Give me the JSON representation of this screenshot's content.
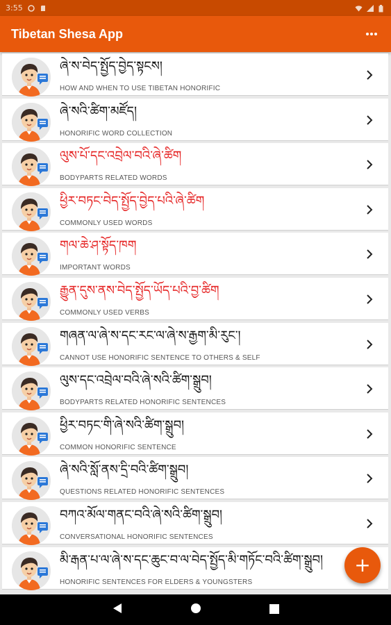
{
  "status_bar": {
    "time": "3:55"
  },
  "app_bar": {
    "title": "Tibetan Shesa App"
  },
  "colors": {
    "accent": "#e8590c",
    "title_black": "#111111",
    "title_red": "#e52222"
  },
  "items": [
    {
      "title": "ཞེ་ས་བེད་སྤྱོད་བྱེད་སྟངས།",
      "subtitle": "HOW AND WHEN TO USE TIBETAN HONORIFIC",
      "color": "black"
    },
    {
      "title": "ཞེ་སའི་ཚིག་མཛོད།",
      "subtitle": "HONORIFIC WORD COLLECTION",
      "color": "black"
    },
    {
      "title": "ལུས་པོ་དང་འབྲེལ་བའི་ཞེ་ཚིག",
      "subtitle": "BODYPARTS RELATED WORDS",
      "color": "red"
    },
    {
      "title": "ཕྱིར་བཏང་བེད་སྤྱོད་བྱེད་པའི་ཞེ་ཚིག",
      "subtitle": "COMMONLY USED WORDS",
      "color": "red"
    },
    {
      "title": "གལ་ཆེ་ཤ་སྟོད་ཁག",
      "subtitle": "IMPORTANT WORDS",
      "color": "red"
    },
    {
      "title": "རྒྱུན་དུས་ནས་བེད་སྤྱོད་ཡོད་པའི་བྱ་ཚིག",
      "subtitle": "COMMONLY USED VERBS",
      "color": "red"
    },
    {
      "title": "གཞན་ལ་ཞེ་ས་དང་རང་ལ་ཞེ་ས་རྒྱག་མི་རུང་།",
      "subtitle": "CANNOT USE HONORIFIC SENTENCE TO OTHERS & SELF",
      "color": "black"
    },
    {
      "title": "ལུས་དང་འབྲེལ་བའི་ཞེ་སའི་ཚིག་སྒྲུབ།",
      "subtitle": "BODYPARTS RELATED HONORIFIC SENTENCES",
      "color": "black"
    },
    {
      "title": "ཕྱིར་བཏང་གི་ཞེ་སའི་ཚིག་སྒྲུབ།",
      "subtitle": "COMMON HONORIFIC SENTENCE",
      "color": "black"
    },
    {
      "title": "ཞེ་སའི་སློ་ནས་དྲི་བའི་ཚིག་སྒྲུབ།",
      "subtitle": "QUESTIONS RELATED HONORIFIC SENTENCES",
      "color": "black"
    },
    {
      "title": "བཀའ་མོལ་གནང་བའི་ཞེ་སའི་ཚིག་སྒྲུབ།",
      "subtitle": "CONVERSATIONAL HONORIFIC SENTENCES",
      "color": "black"
    },
    {
      "title": "མི་རྒན་པ་ལ་ཞེ་ས་དང་ཆུང་བ་ལ་བེད་སྤྱོད་མི་གཏོང་བའི་ཚིག་སྒྲུབ།",
      "subtitle": "HONORIFIC SENTENCES FOR ELDERS & YOUNGSTERS",
      "color": "black"
    }
  ],
  "fab": {
    "label": "+"
  }
}
